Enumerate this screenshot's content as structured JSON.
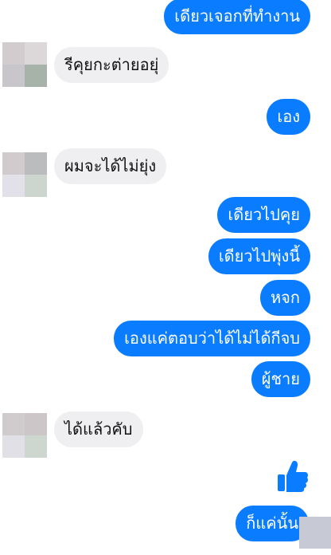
{
  "chat": {
    "messages": [
      {
        "from": "me",
        "text": "เดียวเจอกที่ทำงาน"
      },
      {
        "from": "other",
        "text": "รีคุยกะต่ายอยุ่"
      },
      {
        "from": "me",
        "text": "เอง"
      },
      {
        "from": "other",
        "text": "ผมจะได้ไม่ยุ่ง"
      },
      {
        "from": "me",
        "text": "เดียวไปคุย"
      },
      {
        "from": "me",
        "text": "เดียวไปพุ่งนี้"
      },
      {
        "from": "me",
        "text": "หจก"
      },
      {
        "from": "me",
        "text": "เองแค่ตอบว่าได้ไม่ได้กีจบ"
      },
      {
        "from": "me",
        "text": "ผู้ชาย"
      },
      {
        "from": "other",
        "text": "ได้แล้วคับ"
      },
      {
        "from": "me",
        "type": "icon",
        "icon": "thumbs-up-icon"
      },
      {
        "from": "me",
        "text": "ก็แค่นั้น"
      }
    ]
  },
  "colors": {
    "outgoing_bubble": "#0a7cff",
    "incoming_bubble": "#efeff1",
    "like_icon": "#0a7cff"
  }
}
